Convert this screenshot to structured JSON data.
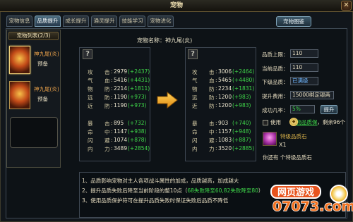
{
  "window": {
    "title": "宠物",
    "close_label": "✕"
  },
  "tabs": [
    {
      "label": "宠物信息",
      "active": false
    },
    {
      "label": "品质提升",
      "active": true
    },
    {
      "label": "成长提升",
      "active": false
    },
    {
      "label": "通灵提升",
      "active": false
    },
    {
      "label": "技能学习",
      "active": false
    },
    {
      "label": "宠物进化",
      "active": false
    }
  ],
  "album_button": "宠物图鉴",
  "pet_list": {
    "title": "宠物列表(2/3)",
    "items": [
      {
        "name": "神九尾(炎)",
        "status": "预备"
      },
      {
        "name": "神九尾(炎)",
        "status": "预备"
      }
    ]
  },
  "pet_name_label": "宠物名称：神九尾(炎)",
  "unknown_icon": "?",
  "stat_labels": [
    {
      "label": "攻",
      "sub": "击"
    },
    {
      "label": "气",
      "sub": "血"
    },
    {
      "label": "物",
      "sub": "防"
    },
    {
      "label": "远",
      "sub": "防"
    },
    {
      "label": "近",
      "sub": "防"
    },
    {
      "label": "暴",
      "sub": "击"
    },
    {
      "label": "命",
      "sub": "中"
    },
    {
      "label": "闪",
      "sub": "避"
    },
    {
      "label": "内",
      "sub": "力"
    }
  ],
  "current_stats": [
    {
      "value": "2979",
      "bonus": "(+2437)"
    },
    {
      "value": "5416",
      "bonus": "(+4431)"
    },
    {
      "value": "2214",
      "bonus": "(+1811)"
    },
    {
      "value": "1190",
      "bonus": "(+973)"
    },
    {
      "value": "1190",
      "bonus": "(+973)"
    },
    {
      "value": "895",
      "bonus": "(+732)"
    },
    {
      "value": "1147",
      "bonus": "(+938)"
    },
    {
      "value": "1074",
      "bonus": "(+878)"
    },
    {
      "value": "3489",
      "bonus": "(+2854)"
    }
  ],
  "next_stats": [
    {
      "value": "3006",
      "bonus": "(+2464)"
    },
    {
      "value": "5465",
      "bonus": "(+4480)"
    },
    {
      "value": "2234",
      "bonus": "(+1831)"
    },
    {
      "value": "1200",
      "bonus": "(+983)"
    },
    {
      "value": "1200",
      "bonus": "(+983)"
    },
    {
      "value": "903",
      "bonus": "(+740)"
    },
    {
      "value": "1157",
      "bonus": "(+948)"
    },
    {
      "value": "1083",
      "bonus": "(+887)"
    },
    {
      "value": "3520",
      "bonus": "(+2885)"
    }
  ],
  "quality": {
    "max_label": "品质上限：",
    "max_value": "110",
    "current_label": "当前品质：",
    "current_value": "110",
    "next_label": "下级品质：",
    "next_value": "已满级",
    "cost_label": "提升费用：",
    "cost_value": "15000绑定银两",
    "rate_label": "成功几率：",
    "rate_value": "5%",
    "upgrade_button": "提升"
  },
  "protect": {
    "checkbox_label": "使用",
    "link_text": "宠物品质保",
    "remaining": "，剩余96个"
  },
  "stone": {
    "name": "特级品质石",
    "count": "X1",
    "own_text": "你还有 个特级品质石"
  },
  "info_lines": [
    {
      "num": "1、",
      "text": "品质影响宠物对主人各项战斗属性的加成，品质越高，加成越大"
    },
    {
      "num": "2、",
      "text": "提升品质失败后降至当前阶段的整10点（",
      "highlight": "68失败降至60,82失败降至80",
      "tail": "）"
    },
    {
      "num": "3、",
      "text": "使用品质保护符可在提升品质失败时保证失败后品质不降低"
    }
  ],
  "watermark": {
    "top": "网页游戏",
    "bottom": "07073.com"
  },
  "colors": {
    "accent_green": "#3fd84a",
    "title_gold": "#f2e3b4",
    "pet_name_orange": "#e8a04a",
    "stone_gold": "#d9b24a",
    "watermark_orange": "#e8541e"
  },
  "icons": {
    "arrow": "right-arrow-icon",
    "close": "close-icon",
    "question": "question-icon",
    "stone": "quality-stone-icon",
    "protect": "protect-charm-icon"
  }
}
